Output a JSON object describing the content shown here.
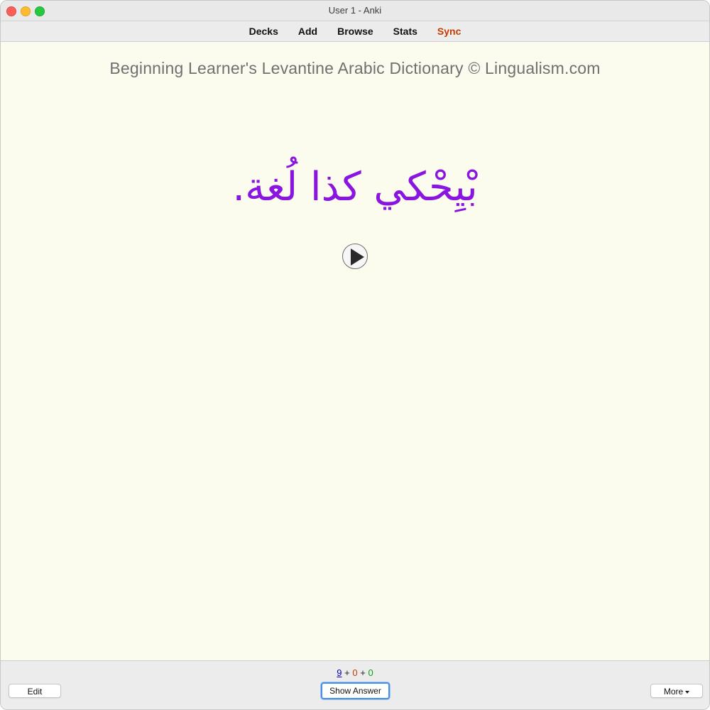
{
  "window": {
    "title": "User 1 - Anki"
  },
  "toolbar": {
    "decks": "Decks",
    "add": "Add",
    "browse": "Browse",
    "stats": "Stats",
    "sync": "Sync",
    "sync_color": "#c43c00"
  },
  "card": {
    "credit": "Beginning Learner's Levantine Arabic Dictionary © Lingualism.com",
    "front_text": "بْيِحْكي كذا لُغة.",
    "front_text_color": "#8a14e0",
    "audio_icon": "play-icon"
  },
  "bottom": {
    "count_new": "9",
    "count_learn": "0",
    "count_review": "0",
    "plus": "+",
    "edit_label": "Edit",
    "show_answer_label": "Show Answer",
    "more_label": "More"
  }
}
